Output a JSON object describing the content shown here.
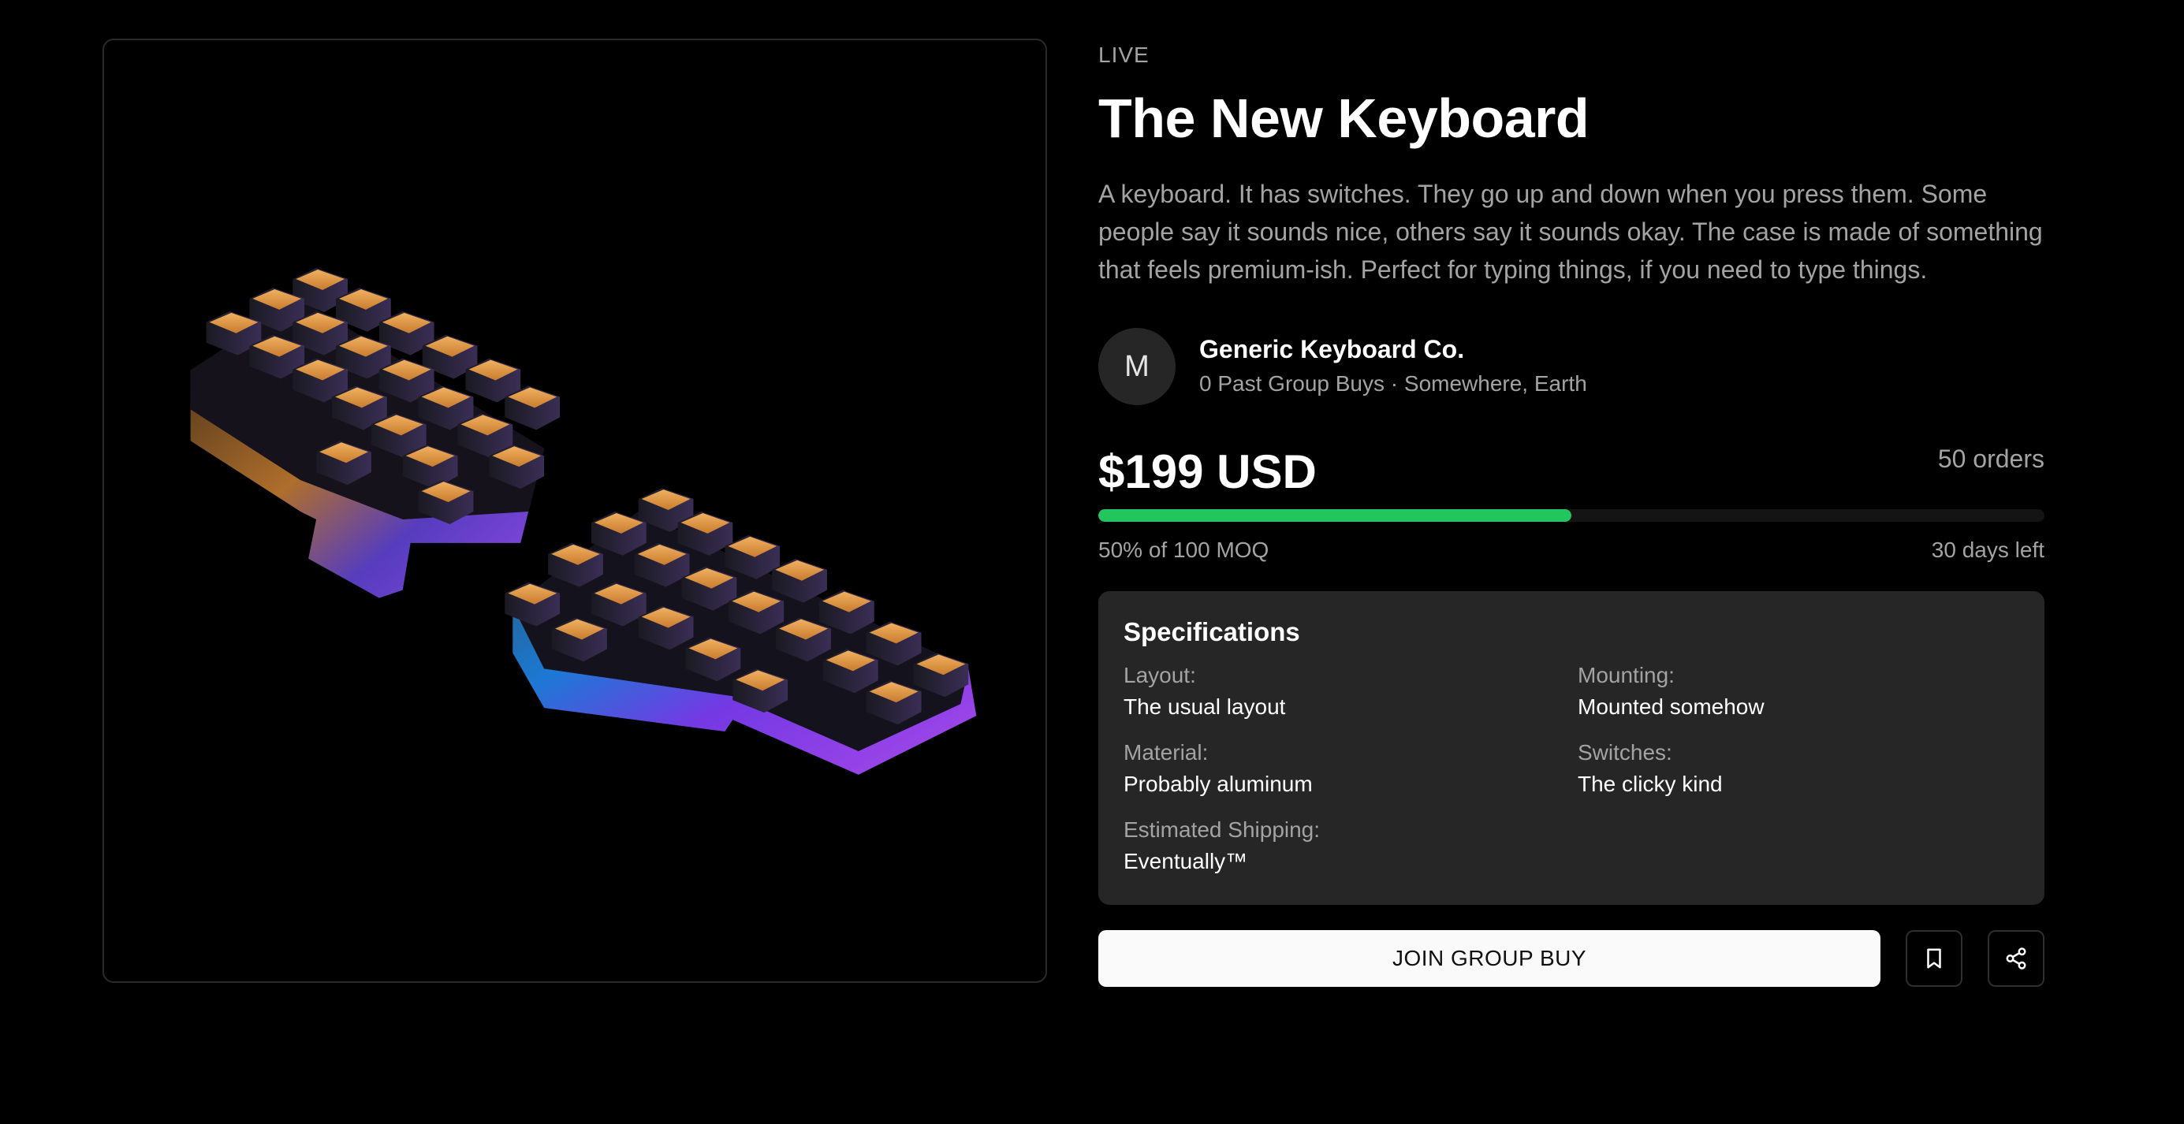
{
  "product": {
    "status": "LIVE",
    "title": "The New Keyboard",
    "description": "A keyboard. It has switches. They go up and down when you press them. Some people say it sounds nice, others say it sounds okay. The case is made of something that feels premium-ish. Perfect for typing things, if you need to type things.",
    "image_icon": "split-keyboard-render"
  },
  "seller": {
    "avatar_letter": "M",
    "name": "Generic Keyboard Co.",
    "meta": "0 Past Group Buys · Somewhere, Earth"
  },
  "pricing": {
    "price": "$199 USD",
    "orders": "50 orders",
    "progress_percent": 50,
    "moq_text": "50% of 100 MOQ",
    "days_left": "30 days left"
  },
  "specifications": {
    "title": "Specifications",
    "items": [
      {
        "label": "Layout:",
        "value": "The usual layout"
      },
      {
        "label": "Mounting:",
        "value": "Mounted somehow"
      },
      {
        "label": "Material:",
        "value": "Probably aluminum"
      },
      {
        "label": "Switches:",
        "value": "The clicky kind"
      },
      {
        "label": "Estimated Shipping:",
        "value": "Eventually™"
      }
    ]
  },
  "actions": {
    "join_label": "JOIN GROUP BUY",
    "bookmark_icon": "bookmark-icon",
    "share_icon": "share-icon"
  },
  "colors": {
    "background": "#000000",
    "accent_progress": "#22c55e",
    "panel": "#262626",
    "muted_text": "#a3a3a3",
    "keycap_top": "#e39a44",
    "case_iridescent": "#8b3cf0"
  }
}
